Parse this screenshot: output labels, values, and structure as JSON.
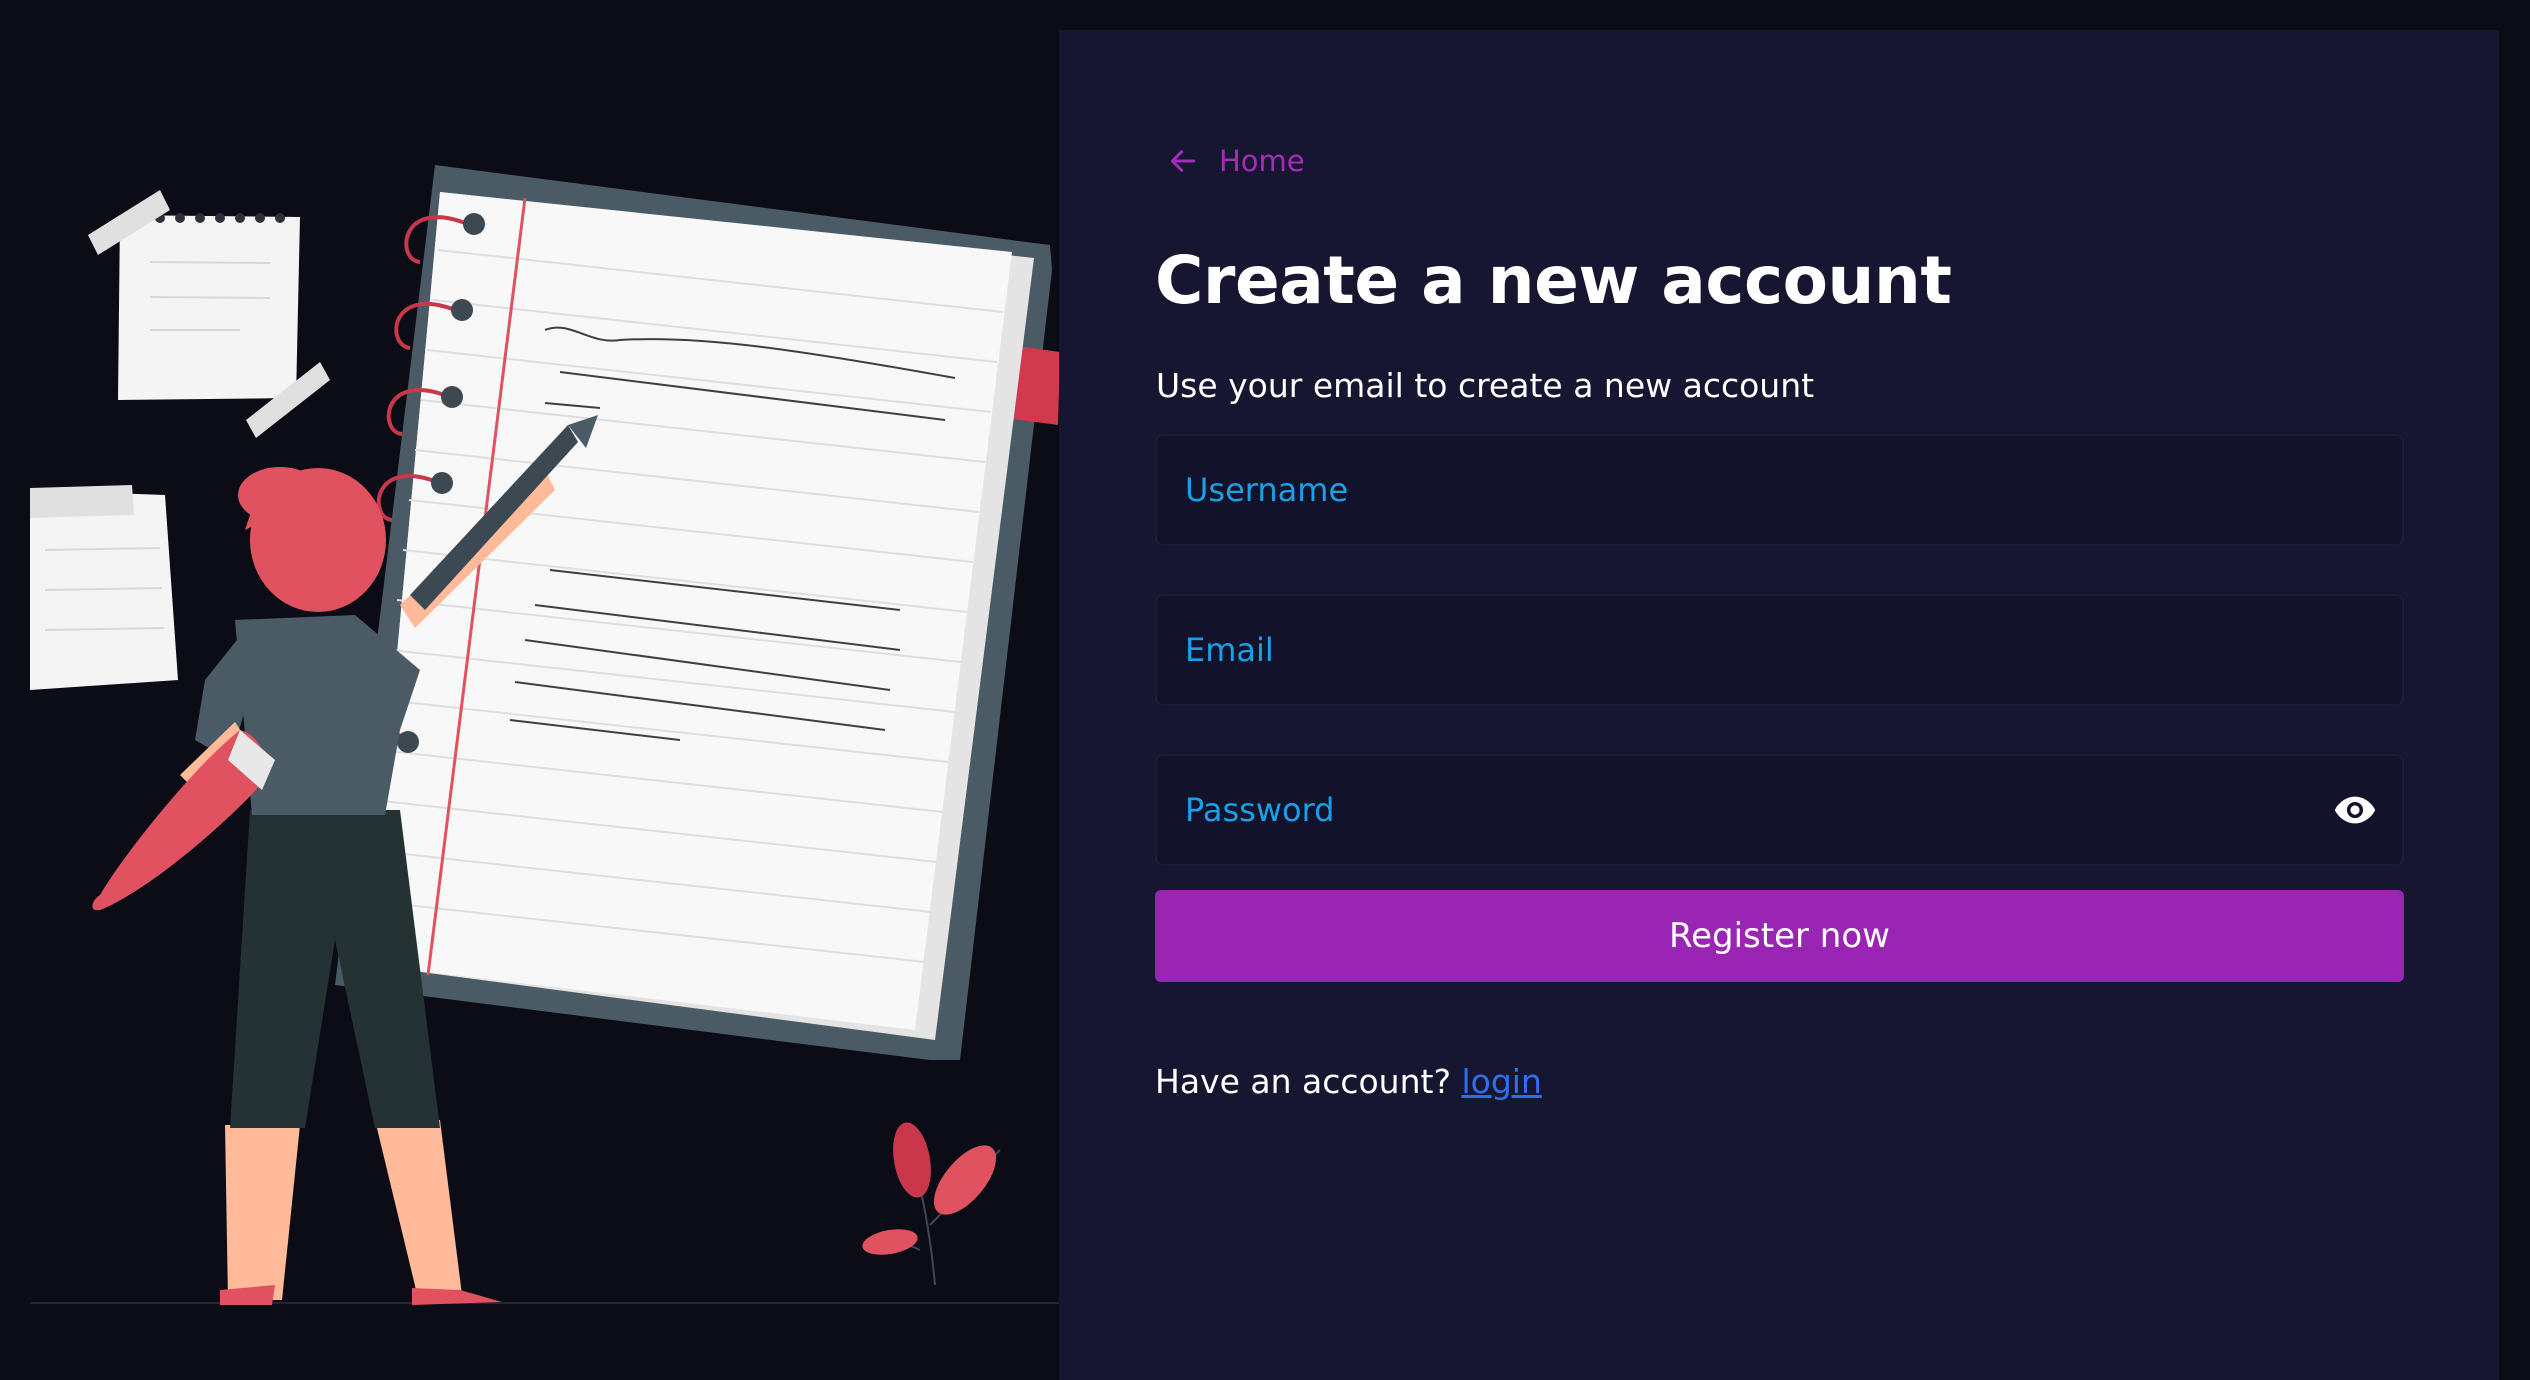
{
  "nav": {
    "home_label": "Home"
  },
  "heading": {
    "title": "Create a new account",
    "subtitle": "Use your email to create a new account"
  },
  "form": {
    "username_placeholder": "Username",
    "email_placeholder": "Email",
    "password_placeholder": "Password",
    "submit_label": "Register now"
  },
  "footer": {
    "prompt": "Have an account?",
    "login_link": "login"
  },
  "icons": {
    "back": "arrow-left-icon",
    "password_toggle": "eye-icon"
  },
  "colors": {
    "page_background": "#0b0c15",
    "panel_background": "#161630",
    "input_background": "#12132a",
    "accent": "#9a25b5",
    "home_link": "#a52bbd",
    "placeholder": "#1aa0e6",
    "link": "#2f6ef0",
    "text": "#ffffff"
  }
}
